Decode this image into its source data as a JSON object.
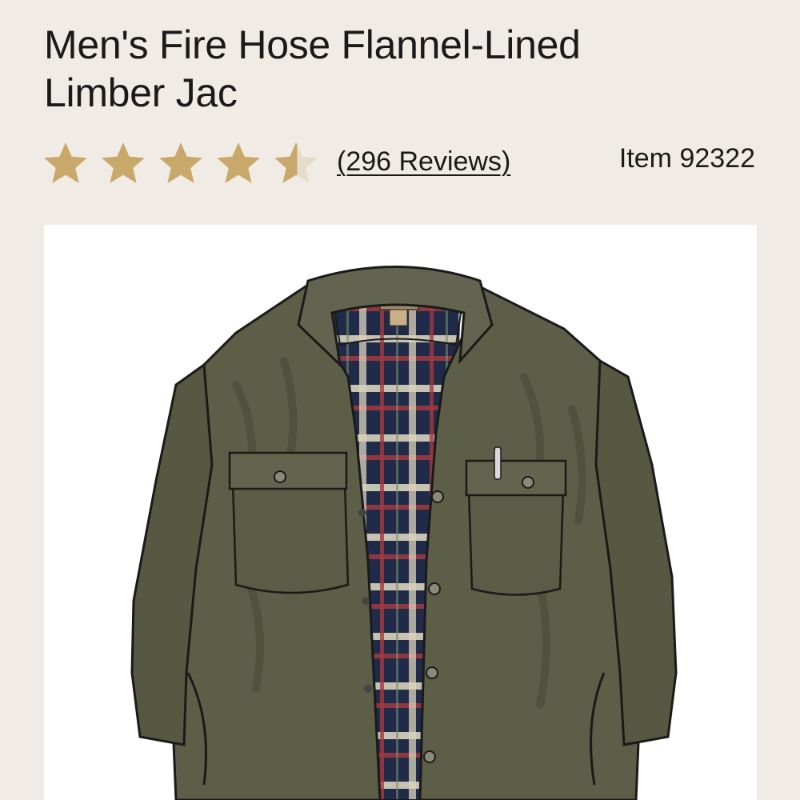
{
  "product": {
    "title_line1": "Men's Fire Hose Flannel-Lined",
    "title_line2": "Limber Jac",
    "rating": 4.5,
    "rating_max": 5,
    "reviews_label": "(296 Reviews)",
    "item_label": "Item 92322"
  },
  "colors": {
    "background": "#f0ece5",
    "star_gold": "#c9a96b",
    "star_empty": "#e6dccb",
    "jacket": "#5c5e48",
    "flannel_navy": "#1f2b48",
    "flannel_red": "#a23a3e"
  },
  "icons": {
    "star": "star-icon",
    "half_star": "half-star-icon"
  }
}
